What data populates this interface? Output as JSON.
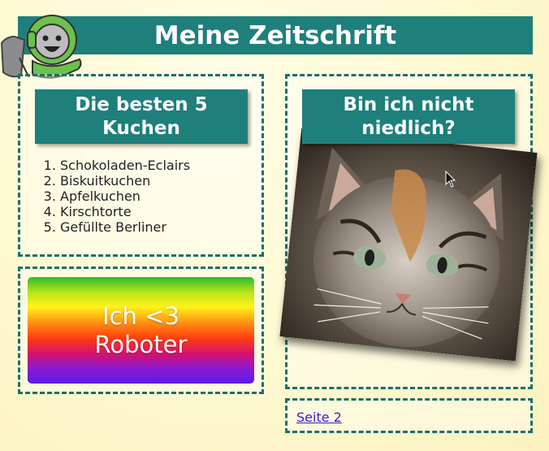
{
  "page": {
    "title": "Meine Zeitschrift"
  },
  "cakes_section": {
    "heading": "Die besten 5 Kuchen",
    "items": [
      "Schokoladen-Eclairs",
      "Biskuitkuchen",
      "Apfelkuchen",
      "Kirschtorte",
      "Gefüllte Berliner"
    ]
  },
  "robot_section": {
    "line1": "Ich <3",
    "line2": "Roboter"
  },
  "cat_section": {
    "heading": "Bin ich nicht niedlich?",
    "image_icon": "kitten-photo"
  },
  "footer": {
    "link_label": "Seite 2"
  },
  "icons": {
    "mascot": "robot-mascot-icon",
    "cursor": "mouse-pointer-icon"
  },
  "colors": {
    "accent": "#1e7f7b",
    "link": "#3a1ccf",
    "background": "#fff9d0"
  }
}
